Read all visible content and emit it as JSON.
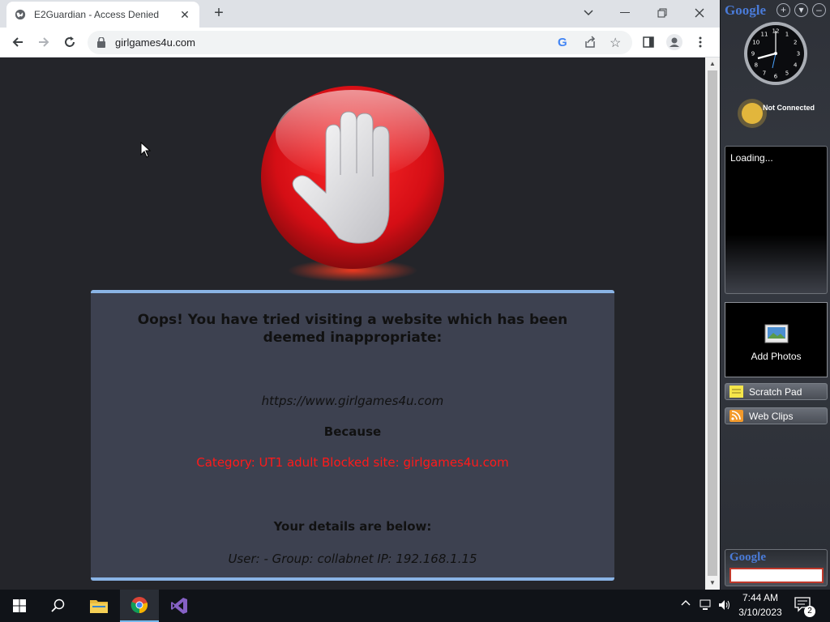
{
  "browser": {
    "tab_title": "E2Guardian - Access Denied",
    "url": "girlgames4u.com"
  },
  "page": {
    "heading": "Oops! You have tried visiting a website which has been deemed inappropriate:",
    "blocked_url": "https://www.girlgames4u.com",
    "because_label": "Because",
    "reason": "Category: UT1 adult   Blocked site: girlgames4u.com",
    "details_label": "Your details are below:",
    "user_info": "User: -    Group: collabnet    IP: 192.168.1.15"
  },
  "gadgets": {
    "logo": "Google",
    "weather_status": "Not Connected",
    "feed_status": "Loading...",
    "photos_label": "Add Photos",
    "scratch_pad_label": "Scratch Pad",
    "web_clips_label": "Web Clips",
    "search_logo": "Google",
    "clock_numbers": [
      "12",
      "1",
      "2",
      "3",
      "4",
      "5",
      "6",
      "7",
      "8",
      "9",
      "10",
      "11"
    ]
  },
  "taskbar": {
    "time": "7:44 AM",
    "date": "3/10/2023",
    "notification_count": "2"
  },
  "colors": {
    "page_bg": "#24252a",
    "panel_bg": "#3d4150",
    "panel_border": "#8ab4e6",
    "reason_text": "#ff1a1a",
    "stop_red": "#e0141b"
  }
}
